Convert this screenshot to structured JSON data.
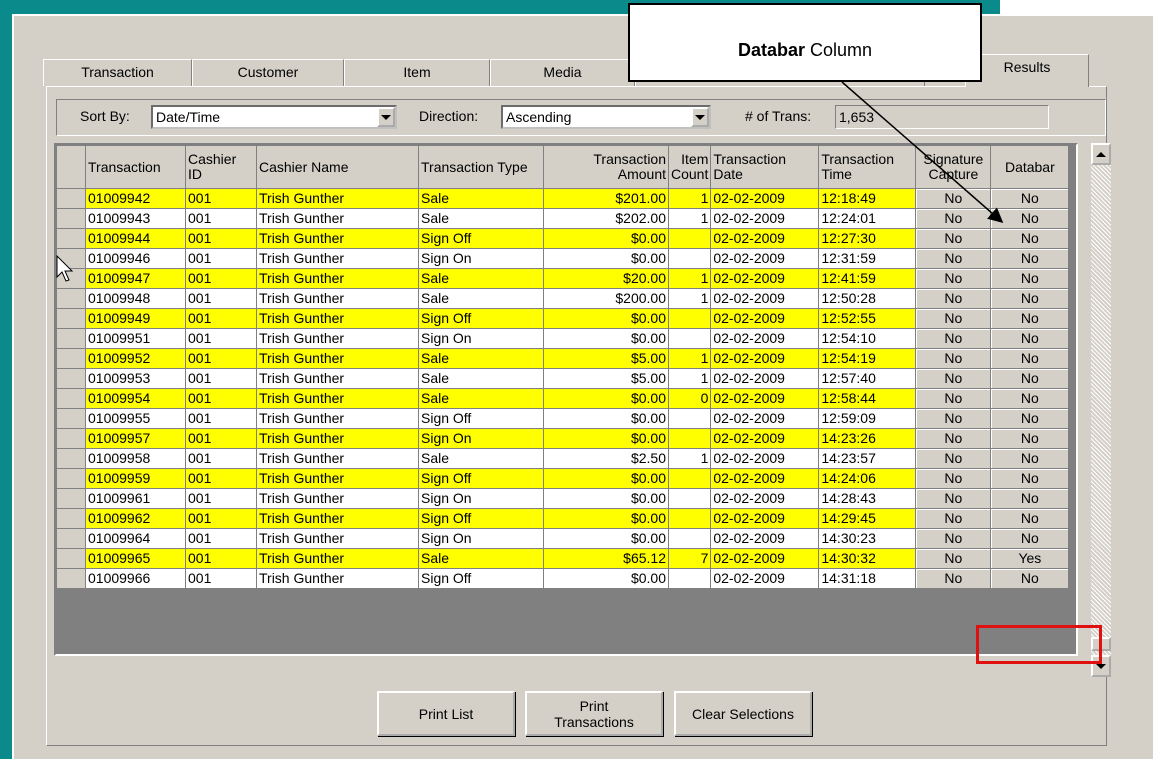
{
  "tabs": [
    {
      "label": "Transaction"
    },
    {
      "label": "Customer"
    },
    {
      "label": "Item"
    },
    {
      "label": "Media"
    },
    {
      "label": "Results"
    }
  ],
  "toolbar": {
    "sort_by_label": "Sort By:",
    "sort_by_value": "Date/Time",
    "direction_label": "Direction:",
    "direction_value": "Ascending",
    "trans_count_label": "# of Trans:",
    "trans_count_value": "1,653"
  },
  "columns": {
    "transaction": "Transaction",
    "cashier_id": "Cashier ID",
    "cashier_name": "Cashier Name",
    "transaction_type": "Transaction Type",
    "transaction_amount": "Transaction Amount",
    "item_count": "Item Count",
    "transaction_date": "Transaction Date",
    "transaction_time": "Transaction Time",
    "signature_capture": "Signature Capture",
    "databar": "Databar"
  },
  "rows": [
    {
      "id": "01009942",
      "cid": "001",
      "name": "Trish Gunther",
      "type": "Sale",
      "amount": "$201.00",
      "count": "1",
      "date": "02-02-2009",
      "time": "12:18:49",
      "sig": "No",
      "databar": "No",
      "hl": true
    },
    {
      "id": "01009943",
      "cid": "001",
      "name": "Trish Gunther",
      "type": "Sale",
      "amount": "$202.00",
      "count": "1",
      "date": "02-02-2009",
      "time": "12:24:01",
      "sig": "No",
      "databar": "No",
      "hl": false
    },
    {
      "id": "01009944",
      "cid": "001",
      "name": "Trish Gunther",
      "type": "Sign Off",
      "amount": "$0.00",
      "count": "",
      "date": "02-02-2009",
      "time": "12:27:30",
      "sig": "No",
      "databar": "No",
      "hl": true
    },
    {
      "id": "01009946",
      "cid": "001",
      "name": "Trish Gunther",
      "type": "Sign On",
      "amount": "$0.00",
      "count": "",
      "date": "02-02-2009",
      "time": "12:31:59",
      "sig": "No",
      "databar": "No",
      "hl": false
    },
    {
      "id": "01009947",
      "cid": "001",
      "name": "Trish Gunther",
      "type": "Sale",
      "amount": "$20.00",
      "count": "1",
      "date": "02-02-2009",
      "time": "12:41:59",
      "sig": "No",
      "databar": "No",
      "hl": true
    },
    {
      "id": "01009948",
      "cid": "001",
      "name": "Trish Gunther",
      "type": "Sale",
      "amount": "$200.00",
      "count": "1",
      "date": "02-02-2009",
      "time": "12:50:28",
      "sig": "No",
      "databar": "No",
      "hl": false
    },
    {
      "id": "01009949",
      "cid": "001",
      "name": "Trish Gunther",
      "type": "Sign Off",
      "amount": "$0.00",
      "count": "",
      "date": "02-02-2009",
      "time": "12:52:55",
      "sig": "No",
      "databar": "No",
      "hl": true
    },
    {
      "id": "01009951",
      "cid": "001",
      "name": "Trish Gunther",
      "type": "Sign On",
      "amount": "$0.00",
      "count": "",
      "date": "02-02-2009",
      "time": "12:54:10",
      "sig": "No",
      "databar": "No",
      "hl": false
    },
    {
      "id": "01009952",
      "cid": "001",
      "name": "Trish Gunther",
      "type": "Sale",
      "amount": "$5.00",
      "count": "1",
      "date": "02-02-2009",
      "time": "12:54:19",
      "sig": "No",
      "databar": "No",
      "hl": true
    },
    {
      "id": "01009953",
      "cid": "001",
      "name": "Trish Gunther",
      "type": "Sale",
      "amount": "$5.00",
      "count": "1",
      "date": "02-02-2009",
      "time": "12:57:40",
      "sig": "No",
      "databar": "No",
      "hl": false
    },
    {
      "id": "01009954",
      "cid": "001",
      "name": "Trish Gunther",
      "type": "Sale",
      "amount": "$0.00",
      "count": "0",
      "date": "02-02-2009",
      "time": "12:58:44",
      "sig": "No",
      "databar": "No",
      "hl": true
    },
    {
      "id": "01009955",
      "cid": "001",
      "name": "Trish Gunther",
      "type": "Sign Off",
      "amount": "$0.00",
      "count": "",
      "date": "02-02-2009",
      "time": "12:59:09",
      "sig": "No",
      "databar": "No",
      "hl": false
    },
    {
      "id": "01009957",
      "cid": "001",
      "name": "Trish Gunther",
      "type": "Sign On",
      "amount": "$0.00",
      "count": "",
      "date": "02-02-2009",
      "time": "14:23:26",
      "sig": "No",
      "databar": "No",
      "hl": true
    },
    {
      "id": "01009958",
      "cid": "001",
      "name": "Trish Gunther",
      "type": "Sale",
      "amount": "$2.50",
      "count": "1",
      "date": "02-02-2009",
      "time": "14:23:57",
      "sig": "No",
      "databar": "No",
      "hl": false
    },
    {
      "id": "01009959",
      "cid": "001",
      "name": "Trish Gunther",
      "type": "Sign Off",
      "amount": "$0.00",
      "count": "",
      "date": "02-02-2009",
      "time": "14:24:06",
      "sig": "No",
      "databar": "No",
      "hl": true
    },
    {
      "id": "01009961",
      "cid": "001",
      "name": "Trish Gunther",
      "type": "Sign On",
      "amount": "$0.00",
      "count": "",
      "date": "02-02-2009",
      "time": "14:28:43",
      "sig": "No",
      "databar": "No",
      "hl": false
    },
    {
      "id": "01009962",
      "cid": "001",
      "name": "Trish Gunther",
      "type": "Sign Off",
      "amount": "$0.00",
      "count": "",
      "date": "02-02-2009",
      "time": "14:29:45",
      "sig": "No",
      "databar": "No",
      "hl": true
    },
    {
      "id": "01009964",
      "cid": "001",
      "name": "Trish Gunther",
      "type": "Sign On",
      "amount": "$0.00",
      "count": "",
      "date": "02-02-2009",
      "time": "14:30:23",
      "sig": "No",
      "databar": "No",
      "hl": false
    },
    {
      "id": "01009965",
      "cid": "001",
      "name": "Trish Gunther",
      "type": "Sale",
      "amount": "$65.12",
      "count": "7",
      "date": "02-02-2009",
      "time": "14:30:32",
      "sig": "No",
      "databar": "Yes",
      "hl": true
    },
    {
      "id": "01009966",
      "cid": "001",
      "name": "Trish Gunther",
      "type": "Sign Off",
      "amount": "$0.00",
      "count": "",
      "date": "02-02-2009",
      "time": "14:31:18",
      "sig": "No",
      "databar": "No",
      "hl": false
    }
  ],
  "buttons": {
    "print_list": "Print List",
    "print_transactions": "Print Transactions",
    "clear_selections": "Clear Selections"
  },
  "callout": {
    "bold": "Databar",
    "rest": " Column"
  },
  "colors": {
    "highlight_row": "#ffff00",
    "annotation_box": "#e01010",
    "window_bg": "#d4d0c8"
  }
}
